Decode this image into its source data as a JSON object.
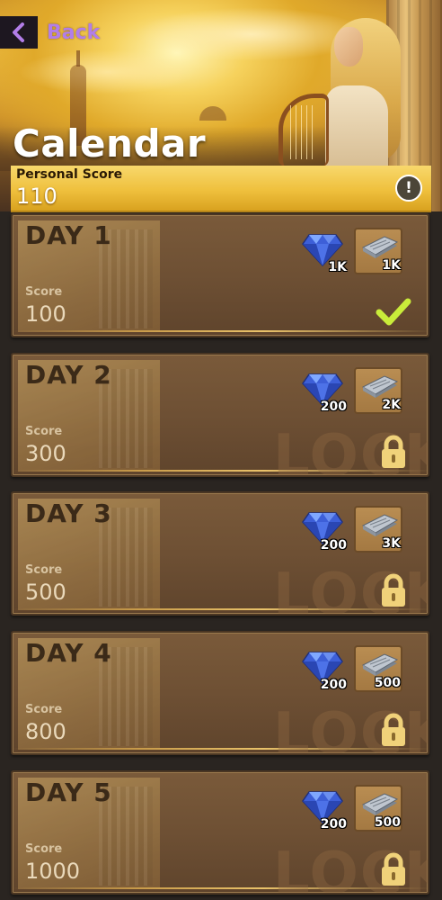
{
  "header": {
    "back_label": "Back",
    "title": "Calendar"
  },
  "personal_score": {
    "label": "Personal Score",
    "value": "110"
  },
  "lock_watermark": "LOCK",
  "days": [
    {
      "label": "DAY  1",
      "score_label": "Score",
      "score": "100",
      "gem_amount": "1K",
      "cash_amount": "1K",
      "status": "completed"
    },
    {
      "label": "DAY  2",
      "score_label": "Score",
      "score": "300",
      "gem_amount": "200",
      "cash_amount": "2K",
      "status": "locked"
    },
    {
      "label": "DAY  3",
      "score_label": "Score",
      "score": "500",
      "gem_amount": "200",
      "cash_amount": "3K",
      "status": "locked"
    },
    {
      "label": "DAY  4",
      "score_label": "Score",
      "score": "800",
      "gem_amount": "200",
      "cash_amount": "500",
      "status": "locked"
    },
    {
      "label": "DAY  5",
      "score_label": "Score",
      "score": "1000",
      "gem_amount": "200",
      "cash_amount": "500",
      "status": "locked"
    }
  ],
  "icons": {
    "back": "back-arrow-icon",
    "info": "info-icon",
    "gem": "diamond-gem-icon",
    "cash": "cash-stack-icon",
    "done": "checkmark-icon",
    "locked": "padlock-icon"
  },
  "colors": {
    "accent_purple": "#b27ee8",
    "score_bar_gold": "#efc03d",
    "check_green": "#c9ec3a",
    "lock_yellow": "#f0d27a"
  }
}
